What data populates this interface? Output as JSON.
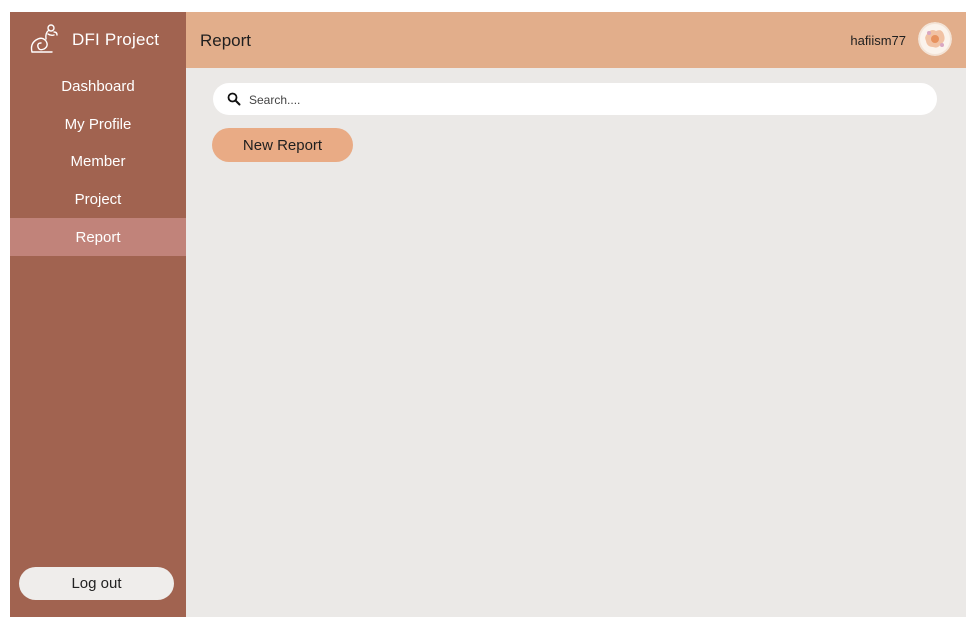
{
  "brand": {
    "title": "DFI Project",
    "logo_icon": "dfi-logo-icon"
  },
  "sidebar": {
    "items": [
      {
        "label": "Dashboard"
      },
      {
        "label": "My Profile"
      },
      {
        "label": "Member"
      },
      {
        "label": "Project"
      },
      {
        "label": "Report",
        "active": true
      }
    ],
    "logout_label": "Log out"
  },
  "header": {
    "title": "Report",
    "username": "hafiism77",
    "avatar_icon": "avatar-icon"
  },
  "main": {
    "search": {
      "placeholder": "Search....",
      "value": "",
      "icon": "search-icon"
    },
    "new_report_label": "New Report"
  },
  "colors": {
    "sidebar": "#a16350",
    "sidebar_active": "#c1837a",
    "header": "#e2ae8b",
    "content_bg": "#ebe9e7",
    "accent_button": "#e9ab85"
  }
}
